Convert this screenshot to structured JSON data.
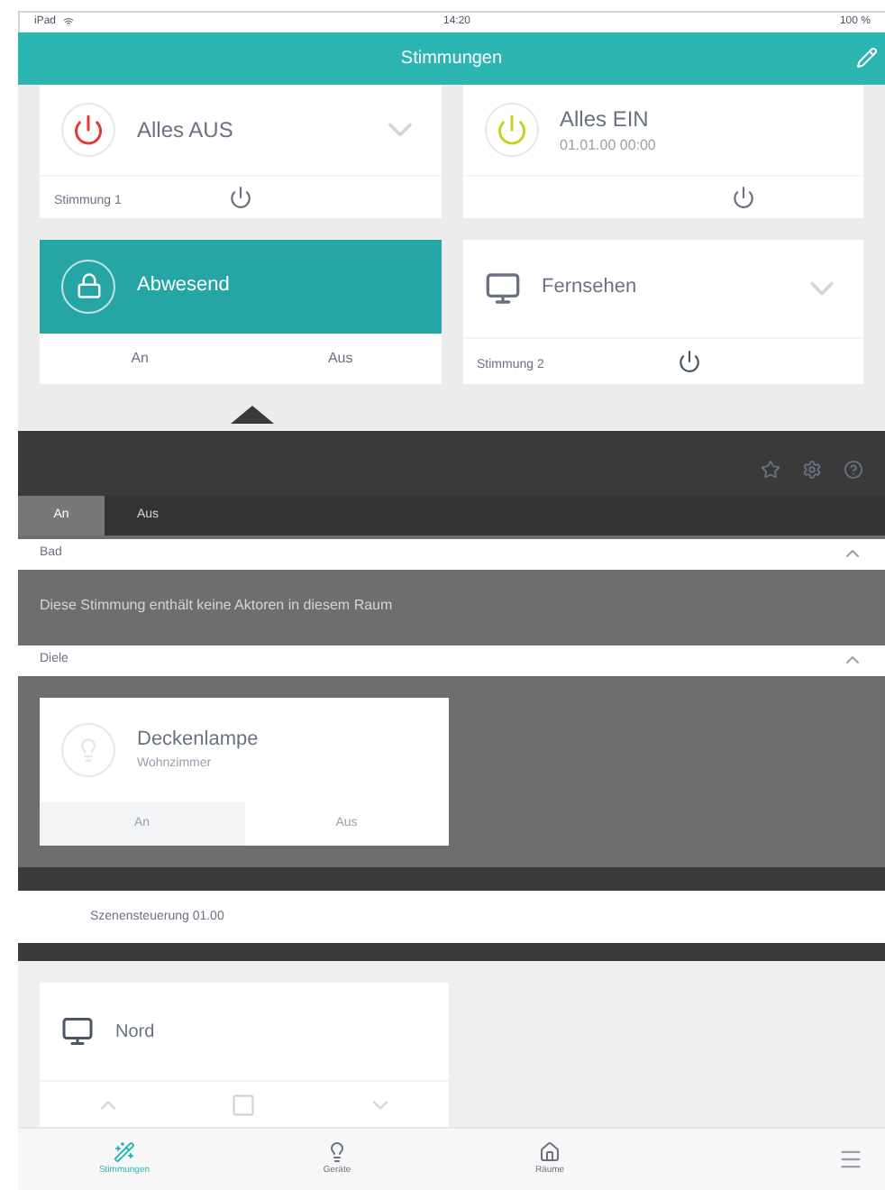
{
  "status_bar": {
    "carrier": "iPad",
    "time": "14:20",
    "battery": "100 %"
  },
  "header": {
    "title": "Stimmungen"
  },
  "scenes": [
    {
      "kind": "power",
      "name": "Alles AUS",
      "footer": "Stimmung 1",
      "color": "#e53935",
      "active": false,
      "expandable": true
    },
    {
      "kind": "power",
      "name": "Alles EIN",
      "subtitle": "01.01.00 00:00",
      "color": "#c6d31e",
      "active": false,
      "expandable": false
    },
    {
      "kind": "onoff",
      "name": "Abwesend",
      "on_label": "An",
      "off_label": "Aus",
      "active": true,
      "expandable": false
    },
    {
      "kind": "tv",
      "name": "Fernsehen",
      "footer": "Stimmung 2",
      "active": false,
      "expandable": true
    }
  ],
  "panel": {
    "tabs": [
      {
        "label": "An",
        "selected": true
      },
      {
        "label": "Aus",
        "selected": false
      }
    ],
    "sections": [
      {
        "title": "Bad",
        "expanded": true,
        "message": "Diese Stimmung enthält keine Aktoren in diesem Raum"
      },
      {
        "title": "Diele",
        "expanded": true,
        "devices": [
          {
            "kind": "light",
            "name": "Deckenlampe",
            "room": "Wohnzimmer",
            "on_label": "An",
            "off_label": "Aus",
            "on": false
          }
        ]
      }
    ],
    "summary": "Szenensteuerung 01.00"
  },
  "blinds": [
    {
      "kind": "blind",
      "name": "Nord"
    }
  ],
  "nav": [
    {
      "label": "Stimmungen",
      "selected": true
    },
    {
      "label": "Geräte",
      "selected": false
    },
    {
      "label": "Räume",
      "selected": false
    }
  ]
}
